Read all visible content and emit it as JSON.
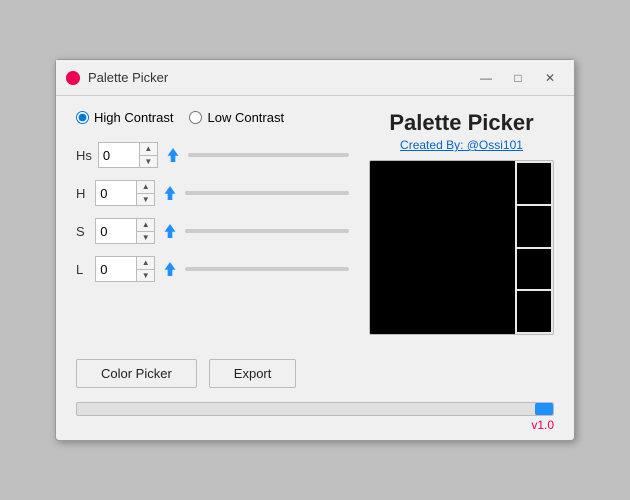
{
  "titlebar": {
    "icon_color": "#e05050",
    "title": "Palette Picker",
    "minimize_label": "—",
    "maximize_label": "□",
    "close_label": "✕"
  },
  "right_panel": {
    "title": "Palette Picker",
    "subtitle": "Created By: @Ossi101"
  },
  "radio": {
    "high_contrast_label": "High Contrast",
    "low_contrast_label": "Low Contrast"
  },
  "sliders": [
    {
      "label": "Hs",
      "value": "0"
    },
    {
      "label": "H",
      "value": "0"
    },
    {
      "label": "S",
      "value": "0"
    },
    {
      "label": "L",
      "value": "0"
    }
  ],
  "buttons": {
    "color_picker": "Color Picker",
    "export": "Export"
  },
  "version": "v1.0"
}
